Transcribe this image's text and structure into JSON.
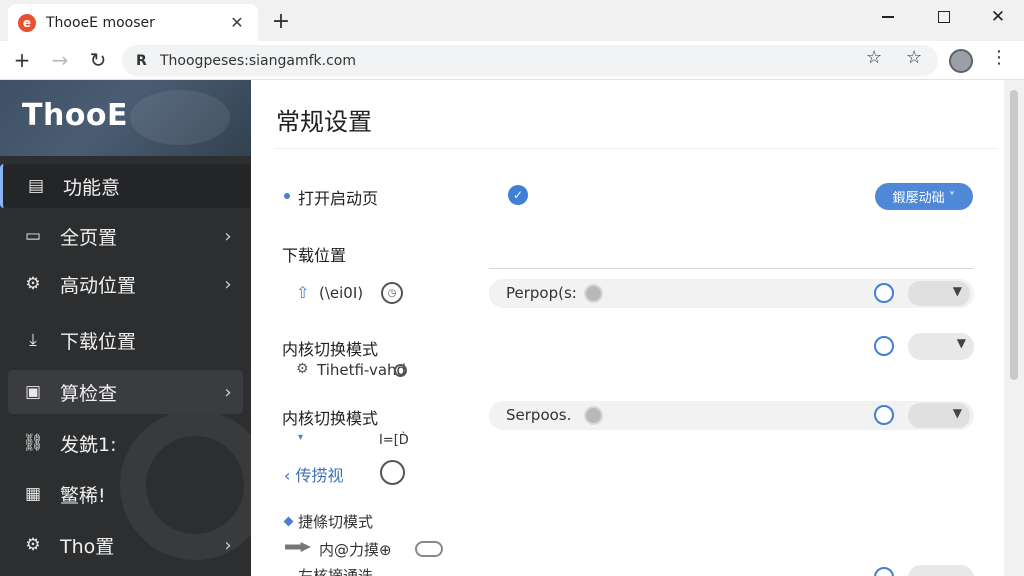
{
  "browser": {
    "tab_title": "ThooeE mooser",
    "tab_favicon": "e",
    "tab_close": "✕",
    "new_tab": "+",
    "url": "Thoogpeses:siangamfk.com",
    "url_icon": "R",
    "window": {
      "min_icon": "minimize-icon",
      "max_icon": "maximize-icon",
      "close_label": "✕"
    }
  },
  "sidebar": {
    "brand": "ThooE",
    "items": [
      {
        "label": "功能意",
        "icon": "document-icon",
        "glyph": "▤",
        "chevron": false,
        "active": true
      },
      {
        "label": "全页置",
        "icon": "monitor-icon",
        "glyph": "▭",
        "chevron": true
      },
      {
        "label": "高动位置",
        "icon": "gear-dots-icon",
        "glyph": "⚙",
        "chevron": true
      },
      {
        "label": "下载位置",
        "icon": "download-icon",
        "glyph": "⤓",
        "chevron": false
      },
      {
        "label": "算检查",
        "icon": "lock-icon",
        "glyph": "▣",
        "chevron": true,
        "highlight": true
      },
      {
        "label": "发銑1:",
        "icon": "link-icon",
        "glyph": "⛓",
        "chevron": false
      },
      {
        "label": "鳘稀!",
        "icon": "grid-icon",
        "glyph": "▦",
        "chevron": false
      },
      {
        "label": "Tho置",
        "icon": "settings-icon",
        "glyph": "⚙",
        "chevron": true
      }
    ]
  },
  "main": {
    "title": "常规设置",
    "open_startup_label": "打开启动页",
    "startup_button": "鍜嬮动础 ˅",
    "download_section": "下载位置",
    "download_value": "(\\ei0I)",
    "field1_text": "Perpop(s:",
    "kernel_label_1": "内核切换模式",
    "kernel_sub_1": "Tihetfi-vahd",
    "kernel_label_2": "内核切换模式",
    "field2_text": "Serpoos.",
    "kernel_sub_2": "I=[D̀",
    "back_label": "‹ 传捞视",
    "switch_label": "捷條切模式",
    "internal_label": "内@力摸⊕",
    "partial_bottom": "左核摘通迭"
  }
}
